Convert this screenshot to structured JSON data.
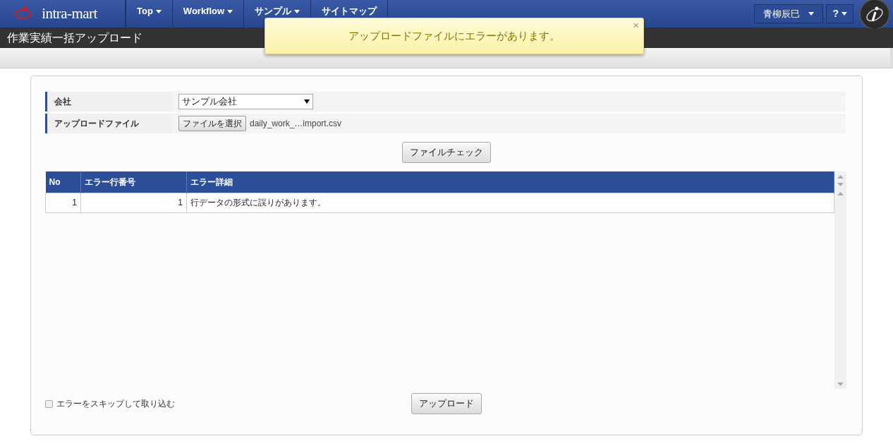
{
  "header": {
    "logo": "intra-mart",
    "nav": [
      {
        "label": "Top",
        "dropdown": true
      },
      {
        "label": "Workflow",
        "dropdown": true
      },
      {
        "label": "サンプル",
        "dropdown": true
      },
      {
        "label": "サイトマップ",
        "dropdown": false
      }
    ],
    "user": "青柳辰巳",
    "help": "?"
  },
  "page_title": "作業実績一括アップロード",
  "toast": {
    "message": "アップロードファイルにエラーがあります。",
    "close": "×"
  },
  "form": {
    "company": {
      "label": "会社",
      "value": "サンプル会社"
    },
    "file": {
      "label": "アップロードファイル",
      "button": "ファイルを選択",
      "filename": "daily_work_…import.csv"
    }
  },
  "check_button": "ファイルチェック",
  "table": {
    "columns": [
      "No",
      "エラー行番号",
      "エラー詳細"
    ],
    "rows": [
      [
        "1",
        "1",
        "行データの形式に誤りがあります。"
      ]
    ]
  },
  "skip_errors": {
    "label": "エラーをスキップして取り込む",
    "checked": false
  },
  "upload_button": "アップロード"
}
